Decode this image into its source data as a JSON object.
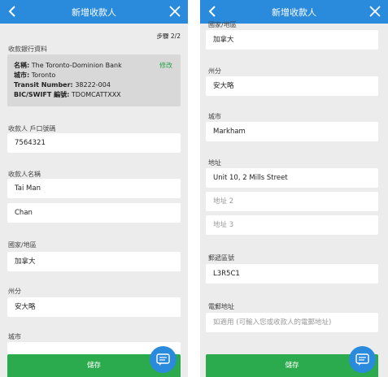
{
  "left": {
    "title": "新增收款人",
    "step": "步驟 2/2",
    "bank_section_label": "收款銀行資料",
    "bank": {
      "name_label": "名稱:",
      "name_value": "The Toronto-Dominion Bank",
      "city_label": "城市:",
      "city_value": "Toronto",
      "transit_label": "Transit Number:",
      "transit_value": "38222-004",
      "swift_label": "BIC/SWIFT 編號:",
      "swift_value": "TDOMCATTXXX",
      "edit": "修改"
    },
    "account_label": "收款人 戶口號碼",
    "account_value": "7564321",
    "name_label": "收款人名稱",
    "first_name": "Tai Man",
    "last_name": "Chan",
    "country_label": "國家/地區",
    "country_value": "加拿大",
    "state_label": "州分",
    "state_value": "安大略",
    "city_label": "城市",
    "save": "儲存"
  },
  "right": {
    "title": "新增收款人",
    "country_label": "國家/地區",
    "country_value": "加拿大",
    "state_label": "州分",
    "state_value": "安大略",
    "city_label": "城市",
    "city_value": "Markham",
    "address_label": "地址",
    "address1": "Unit 10, 2 Mills Street",
    "address2_placeholder": "地址 2",
    "address3_placeholder": "地址 3",
    "postal_label": "郵遞區號",
    "postal_value": "L3R5C1",
    "email_label": "電郵地址",
    "email_placeholder": "如適用 (可輸入您或收款人的電郵地址)",
    "save": "儲存"
  },
  "colors": {
    "header": "#2a8adb",
    "save": "#2bab4d",
    "edit": "#2aa44a"
  },
  "icons": {
    "back": "chevron-left-icon",
    "close": "close-icon",
    "chat": "chat-bubble-icon"
  }
}
